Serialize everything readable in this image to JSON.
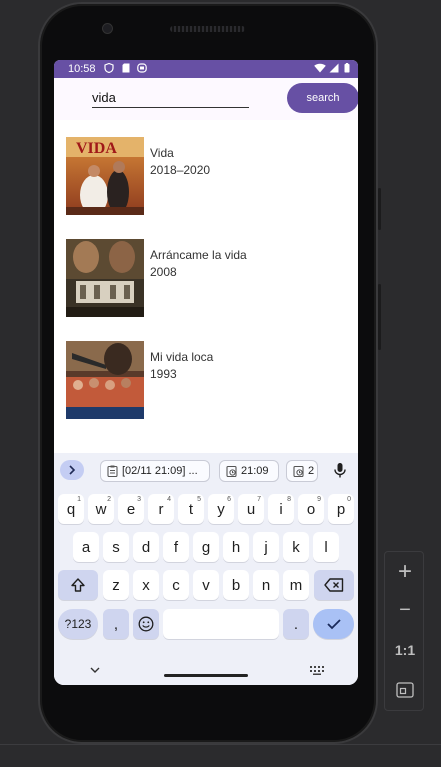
{
  "status_bar": {
    "time": "10:58",
    "background": "#6750a4"
  },
  "search": {
    "value": "vida",
    "button_label": "search",
    "accent": "#6750a4"
  },
  "results": [
    {
      "title": "Vida",
      "years": "2018–2020"
    },
    {
      "title": "Arráncame la vida",
      "years": "2008"
    },
    {
      "title": "Mi vida loca",
      "years": "1993"
    }
  ],
  "keyboard": {
    "suggestions": [
      {
        "icon": "clipboard-icon",
        "label": "[02/11 21:09] ..."
      },
      {
        "icon": "clock-icon",
        "label": "21:09"
      },
      {
        "icon": "clock-icon",
        "label": "2"
      }
    ],
    "rows": [
      [
        {
          "label": "q",
          "num": "1"
        },
        {
          "label": "w",
          "num": "2"
        },
        {
          "label": "e",
          "num": "3"
        },
        {
          "label": "r",
          "num": "4"
        },
        {
          "label": "t",
          "num": "5"
        },
        {
          "label": "y",
          "num": "6"
        },
        {
          "label": "u",
          "num": "7"
        },
        {
          "label": "i",
          "num": "8"
        },
        {
          "label": "o",
          "num": "9"
        },
        {
          "label": "p",
          "num": "0"
        }
      ],
      [
        {
          "label": "a"
        },
        {
          "label": "s"
        },
        {
          "label": "d"
        },
        {
          "label": "f"
        },
        {
          "label": "g"
        },
        {
          "label": "h"
        },
        {
          "label": "j"
        },
        {
          "label": "k"
        },
        {
          "label": "l"
        }
      ],
      [
        {
          "label": "z"
        },
        {
          "label": "x"
        },
        {
          "label": "c"
        },
        {
          "label": "v"
        },
        {
          "label": "b"
        },
        {
          "label": "n"
        },
        {
          "label": "m"
        }
      ]
    ],
    "symbols_label": "?123",
    "comma_label": ",",
    "period_label": "."
  },
  "emulator": {
    "zoom_in": "+",
    "zoom_out": "−",
    "actual_size": "1:1"
  }
}
